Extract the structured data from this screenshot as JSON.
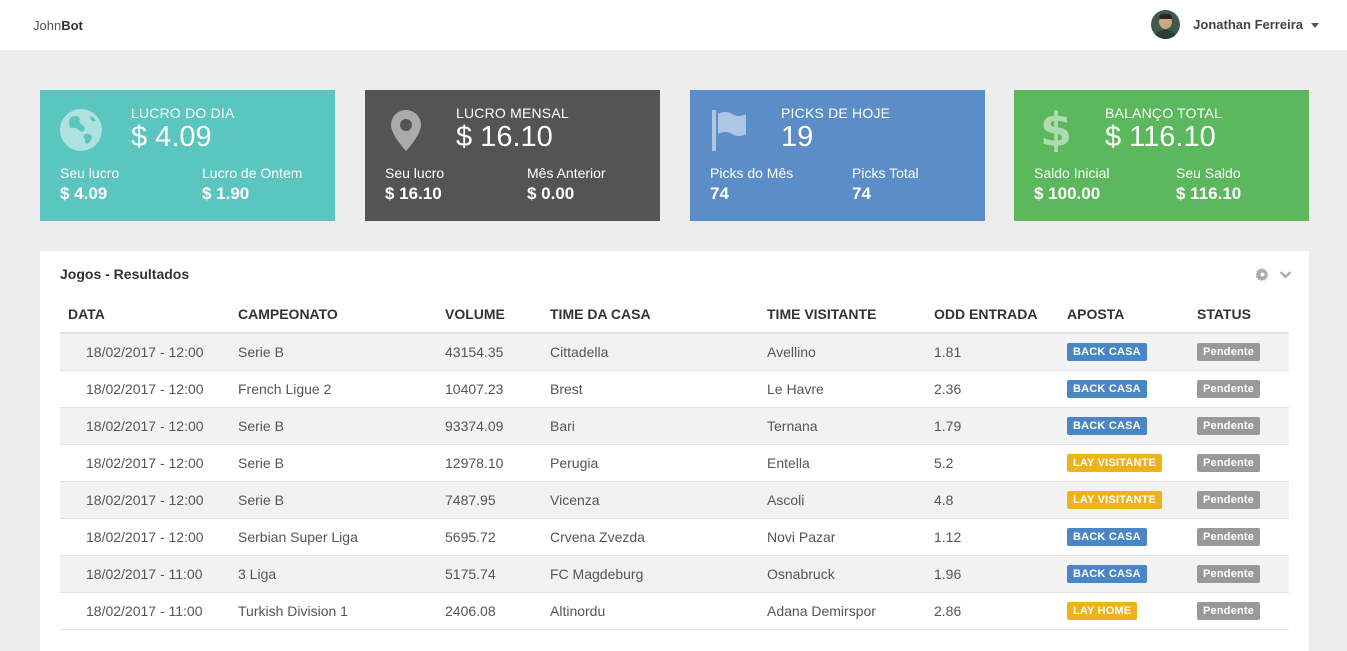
{
  "header": {
    "brand_prefix": "John",
    "brand_bold": "Bot",
    "user_name": "Jonathan Ferreira"
  },
  "cards": [
    {
      "title": "LUCRO DO DIA",
      "value": "$ 4.09",
      "left_label": "Seu lucro",
      "left_value": "$ 4.09",
      "right_label": "Lucro de Ontem",
      "right_value": "$ 1.90",
      "icon": "globe-icon",
      "color": "#5bc5bf"
    },
    {
      "title": "LUCRO MENSAL",
      "value": "$ 16.10",
      "left_label": "Seu lucro",
      "left_value": "$ 16.10",
      "right_label": "Mês Anterior",
      "right_value": "$ 0.00",
      "icon": "map-marker-icon",
      "color": "#545454"
    },
    {
      "title": "PICKS DE HOJE",
      "value": "19",
      "left_label": "Picks do Mês",
      "left_value": "74",
      "right_label": "Picks Total",
      "right_value": "74",
      "icon": "flag-icon",
      "color": "#5b8dc8"
    },
    {
      "title": "BALANÇO TOTAL",
      "value": "$ 116.10",
      "left_label": "Saldo Inicial",
      "left_value": "$ 100.00",
      "right_label": "Seu Saldo",
      "right_value": "$ 116.10",
      "icon": "dollar-icon",
      "color": "#5cb85c"
    }
  ],
  "panel": {
    "title": "Jogos - Resultados",
    "columns": [
      "DATA",
      "CAMPEONATO",
      "VOLUME",
      "TIME DA CASA",
      "TIME VISITANTE",
      "ODD ENTRADA",
      "APOSTA",
      "STATUS"
    ],
    "rows": [
      {
        "data": "18/02/2017 - 12:00",
        "campeonato": "Serie B",
        "volume": "43154.35",
        "casa": "Cittadella",
        "visitante": "Avellino",
        "odd": "1.81",
        "aposta": "BACK CASA",
        "status": "Pendente"
      },
      {
        "data": "18/02/2017 - 12:00",
        "campeonato": "French Ligue 2",
        "volume": "10407.23",
        "casa": "Brest",
        "visitante": "Le Havre",
        "odd": "2.36",
        "aposta": "BACK CASA",
        "status": "Pendente"
      },
      {
        "data": "18/02/2017 - 12:00",
        "campeonato": "Serie B",
        "volume": "93374.09",
        "casa": "Bari",
        "visitante": "Ternana",
        "odd": "1.79",
        "aposta": "BACK CASA",
        "status": "Pendente"
      },
      {
        "data": "18/02/2017 - 12:00",
        "campeonato": "Serie B",
        "volume": "12978.10",
        "casa": "Perugia",
        "visitante": "Entella",
        "odd": "5.2",
        "aposta": "LAY VISITANTE",
        "status": "Pendente"
      },
      {
        "data": "18/02/2017 - 12:00",
        "campeonato": "Serie B",
        "volume": "7487.95",
        "casa": "Vicenza",
        "visitante": "Ascoli",
        "odd": "4.8",
        "aposta": "LAY VISITANTE",
        "status": "Pendente"
      },
      {
        "data": "18/02/2017 - 12:00",
        "campeonato": "Serbian Super Liga",
        "volume": "5695.72",
        "casa": "Crvena Zvezda",
        "visitante": "Novi Pazar",
        "odd": "1.12",
        "aposta": "BACK CASA",
        "status": "Pendente"
      },
      {
        "data": "18/02/2017 - 11:00",
        "campeonato": "3 Liga",
        "volume": "5175.74",
        "casa": "FC Magdeburg",
        "visitante": "Osnabruck",
        "odd": "1.96",
        "aposta": "BACK CASA",
        "status": "Pendente"
      },
      {
        "data": "18/02/2017 - 11:00",
        "campeonato": "Turkish Division 1",
        "volume": "2406.08",
        "casa": "Altinordu",
        "visitante": "Adana Demirspor",
        "odd": "2.86",
        "aposta": "LAY HOME",
        "status": "Pendente"
      }
    ]
  }
}
